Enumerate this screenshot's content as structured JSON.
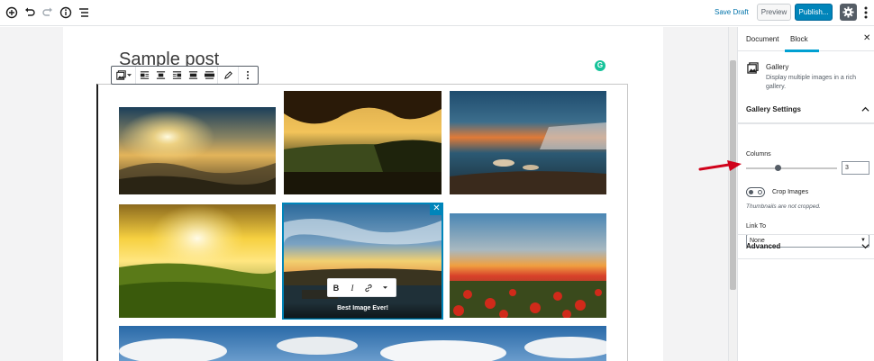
{
  "topbar": {
    "save_draft": "Save Draft",
    "preview": "Preview",
    "publish": "Publish..."
  },
  "post": {
    "title": "Sample post"
  },
  "gallery": {
    "caption": "Best Image Ever!",
    "images": [
      {
        "name": "sunrise-foggy-valley"
      },
      {
        "name": "autumn-sunset-tree"
      },
      {
        "name": "lake-rocks-sunset"
      },
      {
        "name": "green-hills-sunrise"
      },
      {
        "name": "dock-sunset-clouds"
      },
      {
        "name": "poppy-field-sunset"
      },
      {
        "name": "sky-clouds-panorama"
      }
    ]
  },
  "caption_toolbar": {
    "bold": "B",
    "italic": "I"
  },
  "sidebar": {
    "tabs": [
      "Document",
      "Block"
    ],
    "active_tab": "Block",
    "block": {
      "title": "Gallery",
      "description": "Display multiple images in a rich gallery."
    },
    "gallery_settings": {
      "title": "Gallery Settings",
      "columns_label": "Columns",
      "columns_value": "3",
      "crop_label": "Crop Images",
      "crop_help": "Thumbnails are not cropped.",
      "link_to_label": "Link To",
      "link_to_value": "None"
    },
    "advanced": {
      "title": "Advanced"
    }
  },
  "colors": {
    "accent": "#0085ba",
    "tab_active": "#00a0d2",
    "annotation_arrow": "#d0021b"
  }
}
